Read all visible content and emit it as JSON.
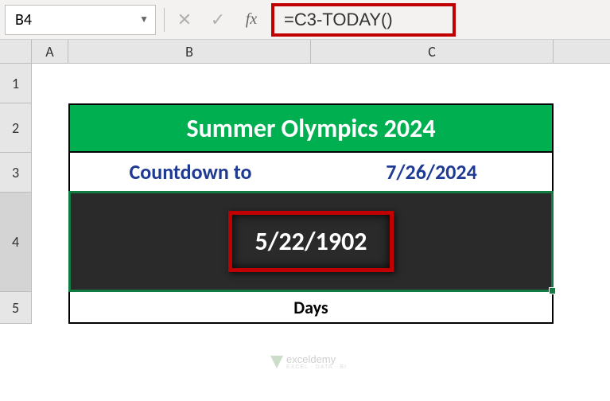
{
  "formulaBar": {
    "cellReference": "B4",
    "formula": "=C3-TODAY()"
  },
  "columns": {
    "A": "A",
    "B": "B",
    "C": "C"
  },
  "rows": {
    "r1": "1",
    "r2": "2",
    "r3": "3",
    "r4": "4",
    "r5": "5"
  },
  "sheet": {
    "title": "Summer Olympics 2024",
    "countdownLabel": "Countdown to",
    "targetDate": "7/26/2024",
    "resultValue": "5/22/1902",
    "daysLabel": "Days"
  },
  "watermark": {
    "brand": "exceldemy",
    "tagline": "EXCEL · DATA · BI"
  },
  "colors": {
    "headerGreen": "#00b050",
    "accentBlue": "#1f3a93",
    "darkCell": "#2a2a2a",
    "highlightRed": "#c00000",
    "selectionGreen": "#107c41"
  }
}
